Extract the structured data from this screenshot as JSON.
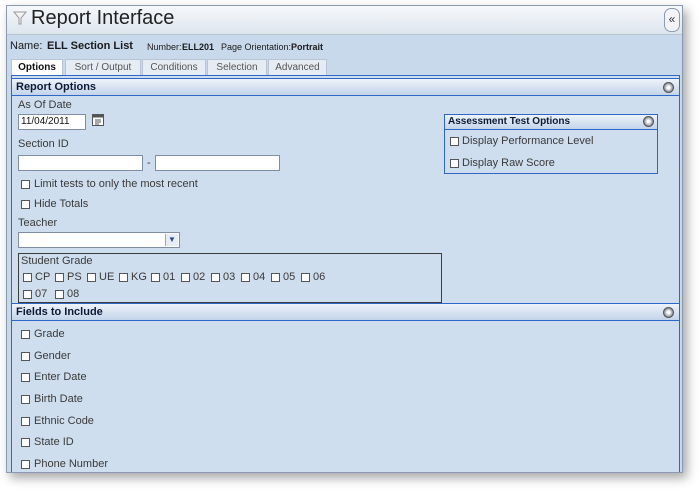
{
  "window": {
    "title": "Report Interface",
    "collapse_icon": "double-chevron-left-icon",
    "collapse_glyph": "«"
  },
  "report_info": {
    "name_label": "Name:",
    "name_value": "ELL Section List",
    "number_label": "Number:",
    "number_value": "ELL201",
    "orientation_label": "Page Orientation:",
    "orientation_value": "Portrait"
  },
  "tabs": [
    {
      "label": "Options",
      "active": true
    },
    {
      "label": "Sort / Output",
      "active": false
    },
    {
      "label": "Conditions",
      "active": false
    },
    {
      "label": "Selection",
      "active": false
    },
    {
      "label": "Advanced",
      "active": false
    }
  ],
  "report_options": {
    "title": "Report Options",
    "as_of_date": {
      "label": "As Of Date",
      "value": "11/04/2011",
      "icon": "calendar-icon"
    },
    "section_id": {
      "label": "Section ID",
      "from_value": "",
      "separator": "-",
      "to_value": ""
    },
    "limit_tests": {
      "label": "Limit tests to only the most recent",
      "checked": false
    },
    "hide_totals": {
      "label": "Hide Totals",
      "checked": false
    },
    "teacher": {
      "label": "Teacher",
      "selected": ""
    },
    "student_grade": {
      "label": "Student Grade",
      "grades": [
        "CP",
        "PS",
        "UE",
        "KG",
        "01",
        "02",
        "03",
        "04",
        "05",
        "06",
        "07",
        "08"
      ]
    },
    "assessment": {
      "title": "Assessment Test Options",
      "options": [
        {
          "label": "Display Performance Level",
          "checked": false
        },
        {
          "label": "Display Raw Score",
          "checked": false
        }
      ]
    }
  },
  "fields": {
    "title": "Fields to Include",
    "items": [
      {
        "label": "Grade",
        "checked": false
      },
      {
        "label": "Gender",
        "checked": false
      },
      {
        "label": "Enter Date",
        "checked": false
      },
      {
        "label": "Birth Date",
        "checked": false
      },
      {
        "label": "Ethnic Code",
        "checked": false
      },
      {
        "label": "State ID",
        "checked": false
      },
      {
        "label": "Phone Number",
        "checked": false
      }
    ]
  }
}
